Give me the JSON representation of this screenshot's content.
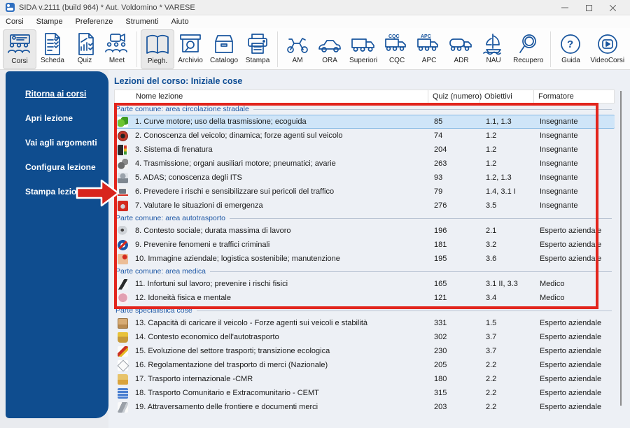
{
  "window": {
    "title": "SIDA v.2111 (build 964) * Aut. Voldomino * VARESE",
    "controls": [
      "minimize",
      "maximize",
      "close"
    ]
  },
  "menu": {
    "items": [
      "Corsi",
      "Stampe",
      "Preferenze",
      "Strumenti",
      "Aiuto"
    ]
  },
  "toolbar": {
    "groups": [
      [
        {
          "id": "corsi",
          "label": "Corsi",
          "active": true
        },
        {
          "id": "scheda",
          "label": "Scheda"
        },
        {
          "id": "quiz",
          "label": "Quiz"
        },
        {
          "id": "meet",
          "label": "Meet"
        }
      ],
      [
        {
          "id": "piegh",
          "label": "Piegh.",
          "active": true
        },
        {
          "id": "archivio",
          "label": "Archivio"
        },
        {
          "id": "catalogo",
          "label": "Catalogo"
        },
        {
          "id": "stampa",
          "label": "Stampa"
        }
      ],
      [
        {
          "id": "am",
          "label": "AM"
        },
        {
          "id": "ora",
          "label": "ORA"
        },
        {
          "id": "superiori",
          "label": "Superiori"
        },
        {
          "id": "cqc",
          "label": "CQC"
        },
        {
          "id": "apc",
          "label": "APC"
        },
        {
          "id": "adr",
          "label": "ADR"
        },
        {
          "id": "nau",
          "label": "NAU"
        },
        {
          "id": "recupero",
          "label": "Recupero"
        }
      ],
      [
        {
          "id": "guida",
          "label": "Guida"
        },
        {
          "id": "videocorsi",
          "label": "VideoCorsi"
        }
      ]
    ]
  },
  "sidebar": {
    "items": [
      {
        "label": "Ritorna ai corsi",
        "current": true
      },
      {
        "label": "Apri lezione"
      },
      {
        "label": "Vai agli argomenti"
      },
      {
        "label": "Configura lezione"
      },
      {
        "label": "Stampa lezione"
      }
    ]
  },
  "main": {
    "heading": "Lezioni del corso: Iniziale cose",
    "table": {
      "columns": [
        "Nome lezione",
        "Quiz (numero)",
        "Obiettivi",
        "Formatore"
      ],
      "sections": [
        {
          "title": "Parte comune: area circolazione stradale",
          "rows": [
            {
              "icon": "eco",
              "name": "1. Curve motore; uso della trasmissione; ecoguida",
              "quiz": "85",
              "obiettivi": "1.1, 1.3",
              "formatore": "Insegnante",
              "selected": true
            },
            {
              "icon": "dynamics",
              "name": "2. Conoscenza del veicolo; dinamica; forze agenti sul veicolo",
              "quiz": "74",
              "obiettivi": "1.2",
              "formatore": "Insegnante"
            },
            {
              "icon": "brakes",
              "name": "3. Sistema di frenatura",
              "quiz": "204",
              "obiettivi": "1.2",
              "formatore": "Insegnante"
            },
            {
              "icon": "transmission",
              "name": "4. Trasmissione; organi ausiliari motore; pneumatici; avarie",
              "quiz": "263",
              "obiettivi": "1.2",
              "formatore": "Insegnante"
            },
            {
              "icon": "adas",
              "name": "5. ADAS; conoscenza degli ITS",
              "quiz": "93",
              "obiettivi": "1.2, 1.3",
              "formatore": "Insegnante"
            },
            {
              "icon": "risk-truck",
              "name": "6. Prevedere i rischi e sensibilizzare sui pericoli del traffico",
              "quiz": "79",
              "obiettivi": "1.4, 3.1 I",
              "formatore": "Insegnante"
            },
            {
              "icon": "emergency",
              "name": "7. Valutare le situazioni di emergenza",
              "quiz": "276",
              "obiettivi": "3.5",
              "formatore": "Insegnante"
            }
          ]
        },
        {
          "title": "Parte comune: area autotrasporto",
          "rows": [
            {
              "icon": "tachograph",
              "name": "8. Contesto sociale; durata massima di lavoro",
              "quiz": "196",
              "obiettivi": "2.1",
              "formatore": "Esperto aziendale"
            },
            {
              "icon": "no-entry",
              "name": "9. Prevenire fenomeni e traffici criminali",
              "quiz": "181",
              "obiettivi": "3.2",
              "formatore": "Esperto aziendale"
            },
            {
              "icon": "hand-heart",
              "name": "10. Immagine aziendale; logistica sostenibile; manutenzione",
              "quiz": "195",
              "obiettivi": "3.6",
              "formatore": "Esperto aziendale"
            }
          ]
        },
        {
          "title": "Parte comune: area medica",
          "rows": [
            {
              "icon": "slip",
              "name": "11. Infortuni sul lavoro; prevenire i rischi fisici",
              "quiz": "165",
              "obiettivi": "3.1 II, 3.3",
              "formatore": "Medico"
            },
            {
              "icon": "fitness",
              "name": "12. Idoneità fisica e mentale",
              "quiz": "121",
              "obiettivi": "3.4",
              "formatore": "Medico"
            }
          ]
        },
        {
          "title": "Parte specialistica cose",
          "rows": [
            {
              "icon": "load-box",
              "name": "13. Capacità di caricare il veicolo - Forze agenti sui veicoli e stabilità",
              "quiz": "331",
              "obiettivi": "1.5",
              "formatore": "Esperto aziendale"
            },
            {
              "icon": "economy",
              "name": "14. Contesto economico dell'autotrasporto",
              "quiz": "302",
              "obiettivi": "3.7",
              "formatore": "Esperto aziendale"
            },
            {
              "icon": "ecology-pen",
              "name": "15. Evoluzione del settore trasporti; transizione ecologica",
              "quiz": "230",
              "obiettivi": "3.7",
              "formatore": "Esperto aziendale"
            },
            {
              "icon": "rules-diamond",
              "name": "16. Regolamentazione del trasporto di merci (Nazionale)",
              "quiz": "205",
              "obiettivi": "2.2",
              "formatore": "Esperto aziendale"
            },
            {
              "icon": "folder-cmr",
              "name": "17. Trasporto internazionale -CMR",
              "quiz": "180",
              "obiettivi": "2.2",
              "formatore": "Esperto aziendale"
            },
            {
              "icon": "book-cemt",
              "name": "18. Trasporto Comunitario e Extracomunitario - CEMT",
              "quiz": "315",
              "obiettivi": "2.2",
              "formatore": "Esperto aziendale"
            },
            {
              "icon": "dove-border",
              "name": "19. Attraversamento delle frontiere e documenti merci",
              "quiz": "203",
              "obiettivi": "2.2",
              "formatore": "Esperto aziendale"
            }
          ]
        }
      ]
    }
  },
  "colors": {
    "accent": "#17549d",
    "sidebar": "#0f4d8f",
    "selection": "#cfe5f8",
    "annotation_red": "#e2251d"
  }
}
